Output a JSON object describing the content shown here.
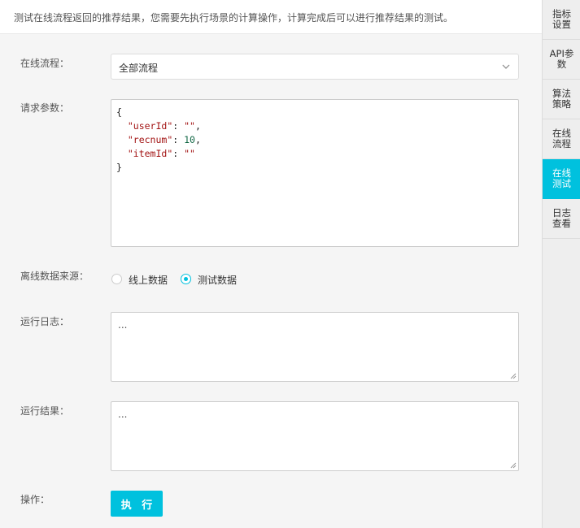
{
  "notice": "测试在线流程返回的推荐结果，您需要先执行场景的计算操作，计算完成后可以进行推荐结果的测试。",
  "form": {
    "flow_label": "在线流程：",
    "flow_value": "全部流程",
    "params_label": "请求参数：",
    "params_lines": {
      "l1": "{",
      "l2_key": "\"userId\"",
      "l2_val": "\"\"",
      "l3_key": "\"recnum\"",
      "l3_val": "10",
      "l4_key": "\"itemId\"",
      "l4_val": "\"\"",
      "l5": "}"
    },
    "source_label": "离线数据来源：",
    "source_options": [
      "线上数据",
      "测试数据"
    ],
    "source_selected": "测试数据",
    "log_label": "运行日志：",
    "log_value": "...",
    "result_label": "运行结果：",
    "result_value": "...",
    "action_label": "操作：",
    "run_button": "执 行"
  },
  "sidebar": {
    "items": [
      {
        "label": "指标设置",
        "active": false
      },
      {
        "label": "API参数",
        "active": false
      },
      {
        "label": "算法策略",
        "active": false
      },
      {
        "label": "在线流程",
        "active": false
      },
      {
        "label": "在线测试",
        "active": true
      },
      {
        "label": "日志查看",
        "active": false
      }
    ]
  },
  "colors": {
    "accent": "#00c1de",
    "string": "#a31515",
    "number": "#116644"
  }
}
